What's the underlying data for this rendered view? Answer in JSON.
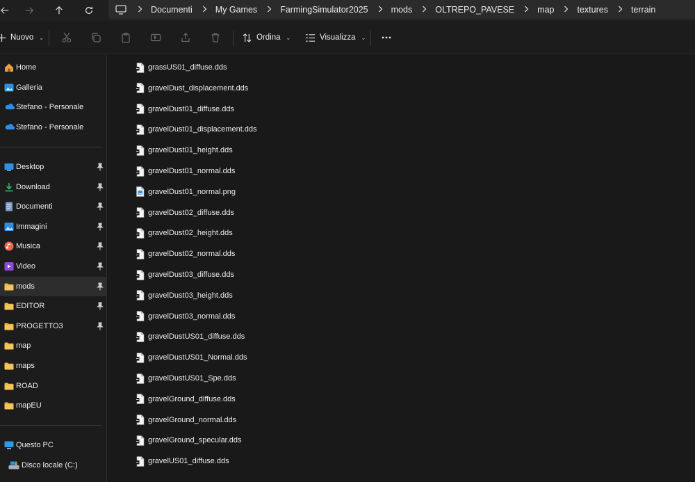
{
  "breadcrumb": [
    "Documenti",
    "My Games",
    "FarmingSimulator2025",
    "mods",
    "OLTREPO_PAVESE",
    "map",
    "textures",
    "terrain"
  ],
  "toolbar": {
    "new_label": "Nuovo",
    "sort_label": "Ordina",
    "view_label": "Visualizza"
  },
  "sidebar": {
    "top": [
      {
        "label": "Home",
        "icon": "home-icon"
      },
      {
        "label": "Galleria",
        "icon": "gallery-icon"
      },
      {
        "label": "Stefano - Personale",
        "icon": "onedrive-icon"
      },
      {
        "label": "Stefano - Personale",
        "icon": "onedrive-icon"
      }
    ],
    "pinned": [
      {
        "label": "Desktop",
        "icon": "desktop-icon",
        "pinned": true
      },
      {
        "label": "Download",
        "icon": "download-icon",
        "pinned": true
      },
      {
        "label": "Documenti",
        "icon": "documents-icon",
        "pinned": true
      },
      {
        "label": "Immagini",
        "icon": "pictures-icon",
        "pinned": true
      },
      {
        "label": "Musica",
        "icon": "music-icon",
        "pinned": true
      },
      {
        "label": "Video",
        "icon": "video-icon",
        "pinned": true
      },
      {
        "label": "mods",
        "icon": "folder-icon",
        "pinned": true,
        "selected": true
      },
      {
        "label": "EDITOR",
        "icon": "folder-icon",
        "pinned": true
      },
      {
        "label": "PROGETTO3",
        "icon": "folder-icon",
        "pinned": true
      },
      {
        "label": "map",
        "icon": "folder-icon",
        "pinned": false
      },
      {
        "label": "maps",
        "icon": "folder-icon",
        "pinned": false
      },
      {
        "label": "ROAD",
        "icon": "folder-icon",
        "pinned": false
      },
      {
        "label": "mapEU",
        "icon": "folder-icon",
        "pinned": false
      }
    ],
    "bottom": [
      {
        "label": "Questo PC",
        "icon": "computer-icon"
      },
      {
        "label": "Disco locale (C:)",
        "icon": "drive-icon"
      }
    ]
  },
  "files": [
    {
      "name": "grassUS01_diffuse.dds",
      "type": "dds"
    },
    {
      "name": "gravelDust_displacement.dds",
      "type": "dds"
    },
    {
      "name": "gravelDust01_diffuse.dds",
      "type": "dds"
    },
    {
      "name": "gravelDust01_displacement.dds",
      "type": "dds"
    },
    {
      "name": "gravelDust01_height.dds",
      "type": "dds"
    },
    {
      "name": "gravelDust01_normal.dds",
      "type": "dds"
    },
    {
      "name": "gravelDust01_normal.png",
      "type": "png"
    },
    {
      "name": "gravelDust02_diffuse.dds",
      "type": "dds"
    },
    {
      "name": "gravelDust02_height.dds",
      "type": "dds"
    },
    {
      "name": "gravelDust02_normal.dds",
      "type": "dds"
    },
    {
      "name": "gravelDust03_diffuse.dds",
      "type": "dds"
    },
    {
      "name": "gravelDust03_height.dds",
      "type": "dds"
    },
    {
      "name": "gravelDust03_normal.dds",
      "type": "dds"
    },
    {
      "name": "gravelDustUS01_diffuse.dds",
      "type": "dds"
    },
    {
      "name": "gravelDustUS01_Normal.dds",
      "type": "dds"
    },
    {
      "name": "gravelDustUS01_Spe.dds",
      "type": "dds"
    },
    {
      "name": "gravelGround_diffuse.dds",
      "type": "dds"
    },
    {
      "name": "gravelGround_normal.dds",
      "type": "dds"
    },
    {
      "name": "gravelGround_specular.dds",
      "type": "dds"
    },
    {
      "name": "gravelUS01_diffuse.dds",
      "type": "dds"
    }
  ],
  "colors": {
    "folder": "#e8b84a",
    "accent_blue": "#2f8fe0",
    "selected_bg": "#2d2d2d"
  }
}
